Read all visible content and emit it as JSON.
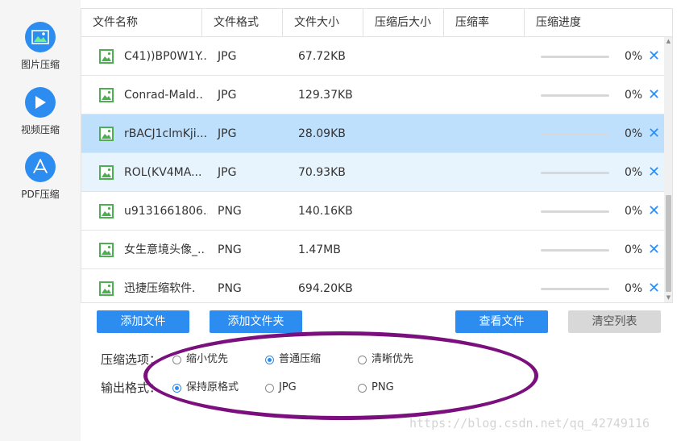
{
  "sidebar": {
    "items": [
      {
        "label": "图片压缩",
        "icon": "image-icon"
      },
      {
        "label": "视频压缩",
        "icon": "play-icon"
      },
      {
        "label": "PDF压缩",
        "icon": "pdf-icon"
      }
    ]
  },
  "table": {
    "headers": [
      "文件名称",
      "文件格式",
      "文件大小",
      "压缩后大小",
      "压缩率",
      "压缩进度"
    ],
    "rows": [
      {
        "name": "C41))BP0W1Y..",
        "format": "JPG",
        "size": "67.72KB",
        "progress": "0%",
        "progress_value": 0
      },
      {
        "name": "Conrad-Mald..",
        "format": "JPG",
        "size": "129.37KB",
        "progress": "0%",
        "progress_value": 0
      },
      {
        "name": "rBACJ1clmKji...",
        "format": "JPG",
        "size": "28.09KB",
        "progress": "0%",
        "progress_value": 0
      },
      {
        "name": "ROL(KV4MA...",
        "format": "JPG",
        "size": "70.93KB",
        "progress": "0%",
        "progress_value": 0
      },
      {
        "name": "u9131661806..",
        "format": "PNG",
        "size": "140.16KB",
        "progress": "0%",
        "progress_value": 0
      },
      {
        "name": "女生意境头像_..",
        "format": "PNG",
        "size": "1.47MB",
        "progress": "0%",
        "progress_value": 0
      },
      {
        "name": "迅捷压缩软件.",
        "format": "PNG",
        "size": "694.20KB",
        "progress": "0%",
        "progress_value": 0
      }
    ],
    "close_glyph": "✕"
  },
  "buttons": {
    "add_file": "添加文件",
    "add_folder": "添加文件夹",
    "view_files": "查看文件",
    "clear_list": "清空列表"
  },
  "options": {
    "compress_label": "压缩选项：",
    "compress_choices": [
      "缩小优先",
      "普通压缩",
      "清晰优先"
    ],
    "compress_selected": "普通压缩",
    "output_label": "输出格式：",
    "output_choices": [
      "保持原格式",
      "JPG",
      "PNG"
    ],
    "output_selected": "保持原格式"
  },
  "watermark": "https://blog.csdn.net/qq_42749116",
  "colors": {
    "accent": "#2d8cf0",
    "row_selected": "#bfe0fc",
    "row_hover": "#e8f4fd",
    "annotation": "#7a0f7d",
    "file_icon": "#4caf50"
  }
}
